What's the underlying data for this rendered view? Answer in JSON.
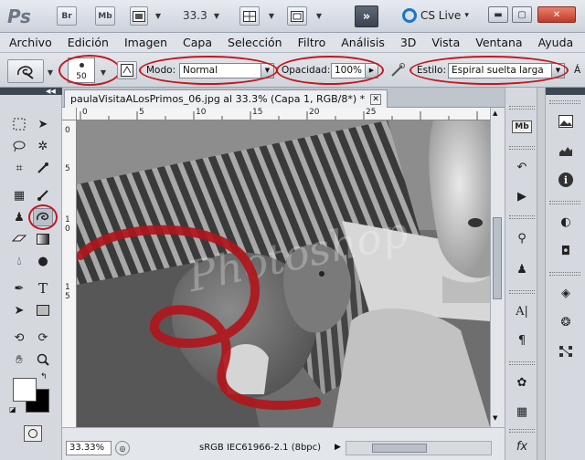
{
  "app": {
    "logo": "Ps",
    "bridge_label": "Br",
    "minibridge_label": "Mb",
    "zoom": "33.3",
    "extensions_glyph": "»",
    "cs_live": "CS Live",
    "cs_live_arrow": "▾"
  },
  "menu": [
    "Archivo",
    "Edición",
    "Imagen",
    "Capa",
    "Selección",
    "Filtro",
    "Análisis",
    "3D",
    "Vista",
    "Ventana",
    "Ayuda"
  ],
  "options": {
    "brush_size": "50",
    "mode_label": "Modo:",
    "mode_value": "Normal",
    "opacity_label": "Opacidad:",
    "opacity_value": "100%",
    "style_label": "Estilo:",
    "style_value": "Espiral suelta larga",
    "area_label": "Á"
  },
  "document": {
    "tab_title": "paulaVisitaALosPrimos_06.jpg al 33.3% (Capa 1, RGB/8*) *",
    "ruler_top": [
      "0",
      "5",
      "10",
      "15",
      "20",
      "25"
    ],
    "ruler_left": [
      "0",
      "5",
      "1",
      "0",
      "1",
      "5"
    ],
    "watermark": "Photoshop",
    "zoom_status": "33.33%",
    "profile_status": "sRGB IEC61966-2.1 (8bpc)"
  },
  "colors": {
    "annotation_red": "#c4161c",
    "stroke_red": "#b0161c",
    "cs_live_blue": "#1b76c8"
  }
}
